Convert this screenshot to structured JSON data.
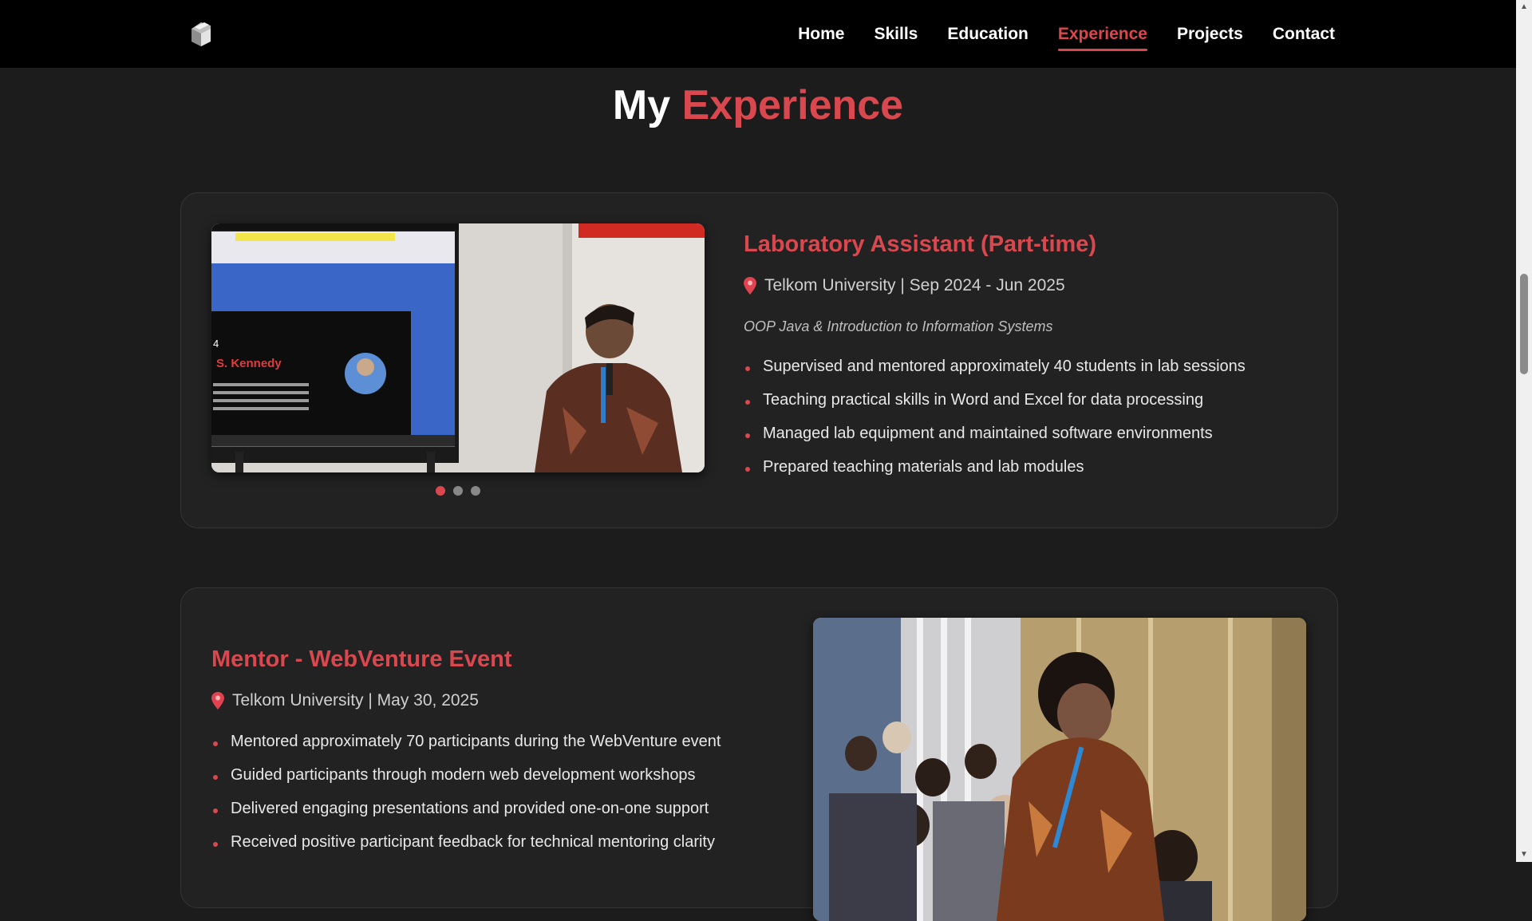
{
  "nav": {
    "items": [
      {
        "label": "Home"
      },
      {
        "label": "Skills"
      },
      {
        "label": "Education"
      },
      {
        "label": "Experience",
        "active": true
      },
      {
        "label": "Projects"
      },
      {
        "label": "Contact"
      }
    ]
  },
  "section": {
    "title_white": "My",
    "title_accent": "Experience"
  },
  "experience": [
    {
      "title": "Laboratory Assistant (Part-time)",
      "meta": "Telkom University | Sep 2024 - Jun 2025",
      "subtitle": "OOP Java & Introduction to Information Systems",
      "bullets": [
        "Supervised and mentored approximately 40 students in lab sessions",
        "Teaching practical skills in Word and Excel for data processing",
        "Managed lab equipment and maintained software environments",
        "Prepared teaching materials and lab modules"
      ],
      "screen_text": {
        "number": "4",
        "name": "S. Kennedy"
      },
      "carousel_dots": 3,
      "active_dot": 0
    },
    {
      "title": "Mentor - WebVenture Event",
      "meta": "Telkom University | May 30, 2025",
      "bullets": [
        "Mentored approximately 70 participants during the WebVenture event",
        "Guided participants through modern web development workshops",
        "Delivered engaging presentations and provided one-on-one support",
        "Received positive participant feedback for technical mentoring clarity"
      ]
    }
  ],
  "colors": {
    "accent": "#d9484e",
    "background": "#1c1c1c",
    "card": "#222222",
    "navbar": "#000000"
  },
  "icons": {
    "location": "map-pin-icon",
    "logo": "site-logo-icon"
  }
}
